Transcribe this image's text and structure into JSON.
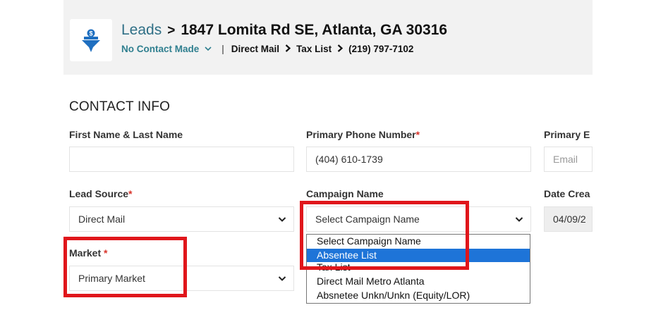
{
  "header": {
    "breadcrumb_root": "Leads",
    "breadcrumb_sep": ">",
    "address": "1847 Lomita Rd SE, Atlanta, GA 30316",
    "status": "No Contact Made",
    "source_label": "Direct Mail",
    "list_label": "Tax List",
    "phone": "(219) 797-7102"
  },
  "section_title": "CONTACT INFO",
  "form": {
    "name": {
      "label": "First Name & Last Name",
      "value": ""
    },
    "phone": {
      "label": "Primary Phone Number",
      "required": "*",
      "value": "(404) 610-1739"
    },
    "email": {
      "label": "Primary E",
      "placeholder": "Email"
    },
    "lead_source": {
      "label": "Lead Source",
      "required": "*",
      "value": "Direct Mail"
    },
    "campaign": {
      "label": "Campaign Name",
      "value": "Select Campaign Name"
    },
    "date_created": {
      "label": "Date Crea",
      "value": "04/09/2"
    },
    "market": {
      "label": "Market",
      "required": "*",
      "value": "Primary Market"
    }
  },
  "campaign_options": [
    "Select Campaign Name",
    "Absentee List",
    "Tax List",
    "Direct Mail Metro Atlanta",
    "Absnetee Unkn/Unkn (Equity/LOR)"
  ],
  "colors": {
    "accent_teal": "#2f6f86",
    "highlight_blue": "#1e74d8",
    "annotation_red": "#e0161b",
    "logo_blue": "#1f6fc0"
  }
}
